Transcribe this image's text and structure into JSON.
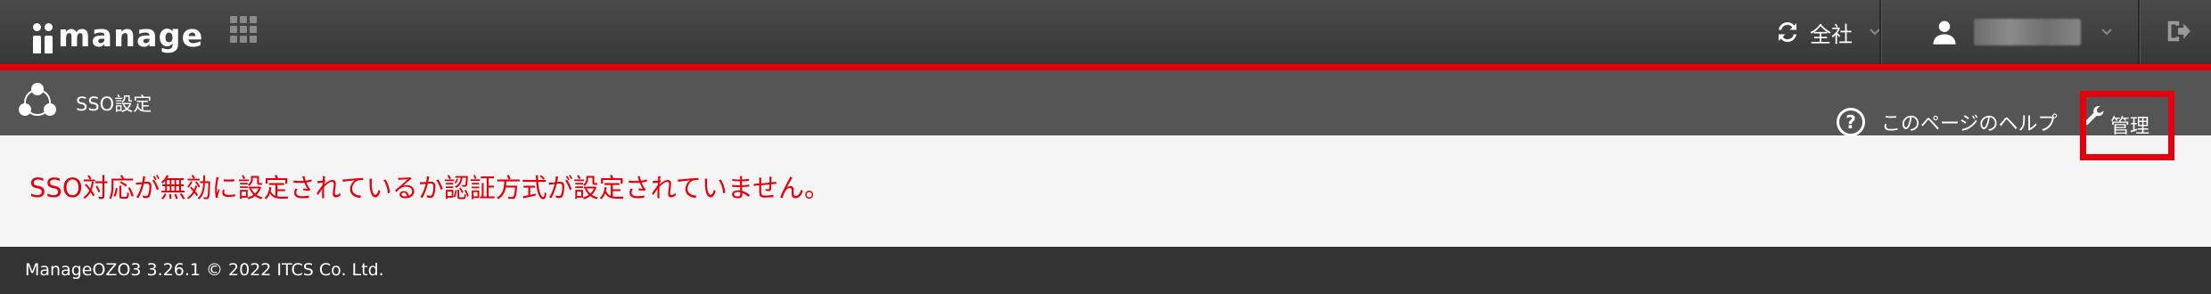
{
  "header": {
    "logo_text": "manage",
    "scope_label": "全社",
    "icons": [
      "apps-grid-icon",
      "sync-icon",
      "chevron-down-icon",
      "user-icon",
      "logout-icon"
    ],
    "accent_color": "#e6000b"
  },
  "subheader": {
    "page_title": "SSO設定",
    "help_label": "このページのヘルプ",
    "help_icon_glyph": "?",
    "admin_label": "管理"
  },
  "main": {
    "message": "SSO対応が無効に設定されているか認証方式が設定されていません。"
  },
  "footer": {
    "text": "ManageOZO3 3.26.1 © 2022 ITCS Co. Ltd."
  }
}
